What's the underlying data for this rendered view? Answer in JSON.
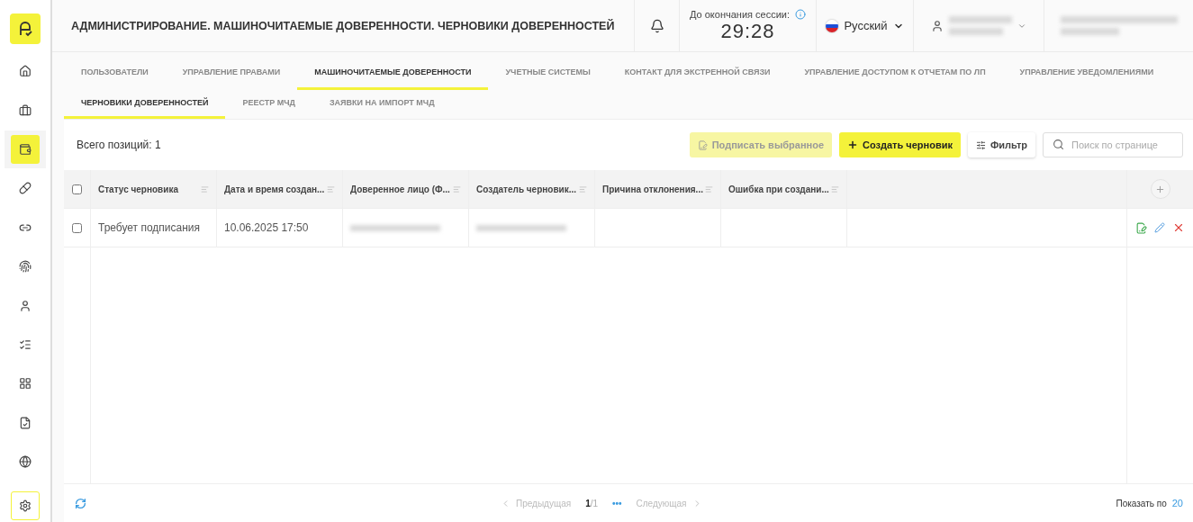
{
  "sidebar": {
    "items": [
      {
        "kind": "home",
        "selected": false,
        "focused": false
      },
      {
        "kind": "briefcase",
        "selected": false,
        "focused": false
      },
      {
        "kind": "wallet",
        "selected": true,
        "focused": false
      },
      {
        "kind": "pills",
        "selected": false,
        "focused": false
      },
      {
        "kind": "link",
        "selected": false,
        "focused": false
      },
      {
        "kind": "fingerprint",
        "selected": false,
        "focused": false
      },
      {
        "kind": "user",
        "selected": false,
        "focused": false
      },
      {
        "kind": "list",
        "selected": false,
        "focused": false
      },
      {
        "kind": "grid",
        "selected": false,
        "focused": false
      },
      {
        "kind": "chart",
        "selected": false,
        "focused": false
      },
      {
        "kind": "globe",
        "selected": false,
        "focused": false
      },
      {
        "kind": "settings",
        "selected": false,
        "focused": true
      }
    ]
  },
  "header": {
    "title": "АДМИНИСТРИРОВАНИЕ. МАШИНОЧИТАЕМЫЕ ДОВЕРЕННОСТИ. ЧЕРНОВИКИ ДОВЕРЕННОСТЕЙ",
    "session_label": "До окончания сессии:",
    "session_time": "29:28",
    "language": "Русский"
  },
  "tabs": [
    {
      "label": "ПОЛЬЗОВАТЕЛИ",
      "selected": false
    },
    {
      "label": "УПРАВЛЕНИЕ ПРАВАМИ",
      "selected": false
    },
    {
      "label": "МАШИНОЧИТАЕМЫЕ ДОВЕРЕННОСТИ",
      "selected": true
    },
    {
      "label": "УЧЕТНЫЕ СИСТЕМЫ",
      "selected": false
    },
    {
      "label": "КОНТАКТ ДЛЯ ЭКСТРЕННОЙ СВЯЗИ",
      "selected": false
    },
    {
      "label": "УПРАВЛЕНИЕ ДОСТУПОМ К ОТЧЕТАМ ПО ЛП",
      "selected": false
    },
    {
      "label": "УПРАВЛЕНИЕ УВЕДОМЛЕНИЯМИ",
      "selected": false
    }
  ],
  "subtabs": [
    {
      "label": "ЧЕРНОВИКИ ДОВЕРЕННОСТЕЙ",
      "selected": true
    },
    {
      "label": "РЕЕСТР МЧД",
      "selected": false
    },
    {
      "label": "ЗАЯВКИ НА ИМПОРТ МЧД",
      "selected": false
    }
  ],
  "toolbar": {
    "total": "Всего позиций: 1",
    "sign_button": {
      "label": "Подписать выбранное",
      "disabled": true
    },
    "create_button": "Создать черновик",
    "filter_button": "Фильтр",
    "search": {
      "placeholder": "Поиск по странице"
    }
  },
  "table": {
    "select_all": {
      "checked": false
    },
    "columns": [
      "Статус черновика",
      "Дата и время создан...",
      "Доверенное лицо (Ф...",
      "Создатель черновик...",
      "Причина отклонения...",
      "Ошибка при создани..."
    ],
    "rows": [
      {
        "checked": false,
        "cells": [
          {
            "kind": "text",
            "text": "Требует подписания"
          },
          {
            "kind": "text",
            "text": "10.06.2025 17:50"
          },
          {
            "kind": "redacted"
          },
          {
            "kind": "redacted"
          },
          {
            "kind": "empty"
          },
          {
            "kind": "empty"
          }
        ]
      }
    ]
  },
  "footer": {
    "prev": {
      "label": "Предыдущая",
      "disabled": true
    },
    "page": "1",
    "pages": "/1",
    "more": "•••",
    "next": {
      "label": "Следующая",
      "disabled": true
    },
    "page_size_label": "Показать по",
    "page_size": "20"
  }
}
